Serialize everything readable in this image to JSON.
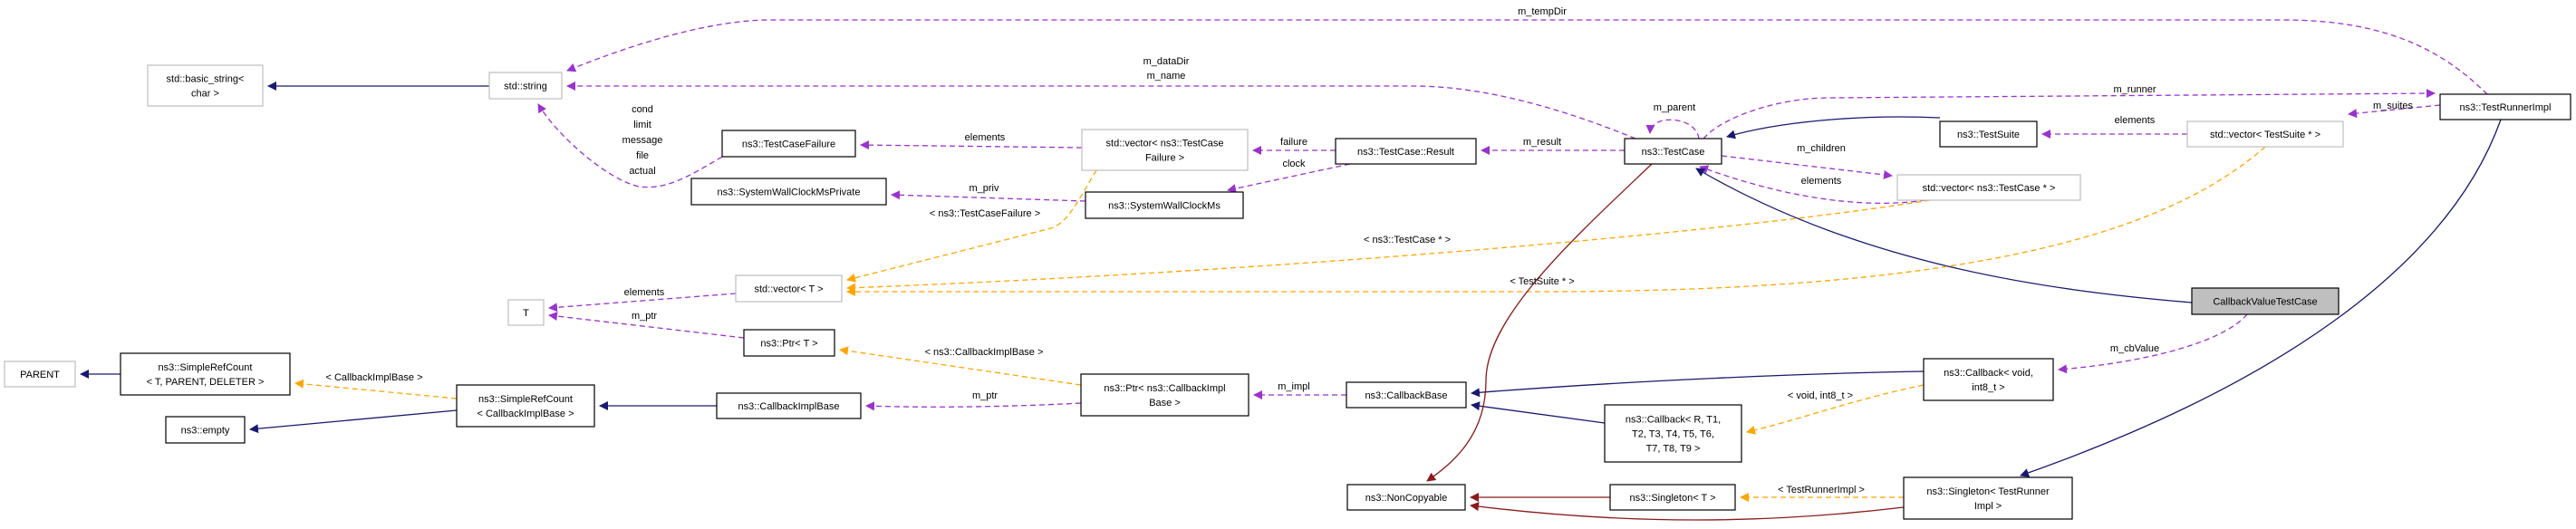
{
  "colors": {
    "inheritance": "#191970",
    "usage": "#9a32cd",
    "template": "#ffa500",
    "private_inheritance": "#8b1a1a",
    "node_border_documented": "#000000",
    "node_border_undocumented": "#bfbfbf",
    "focus_fill": "#bfbfbf"
  },
  "nodes": [
    {
      "id": "basic_string",
      "lines": [
        "std::basic_string<",
        "char >"
      ],
      "kind": "undocumented"
    },
    {
      "id": "string",
      "lines": [
        "std::string"
      ],
      "kind": "undocumented"
    },
    {
      "id": "tcfailure",
      "lines": [
        "ns3::TestCaseFailure"
      ],
      "kind": "documented"
    },
    {
      "id": "swcmpriv",
      "lines": [
        "ns3::SystemWallClockMsPrivate"
      ],
      "kind": "documented"
    },
    {
      "id": "vec_tcf",
      "lines": [
        "std::vector< ns3::TestCase",
        "Failure >"
      ],
      "kind": "undocumented"
    },
    {
      "id": "result",
      "lines": [
        "ns3::TestCase::Result"
      ],
      "kind": "documented"
    },
    {
      "id": "swcm",
      "lines": [
        "ns3::SystemWallClockMs"
      ],
      "kind": "documented"
    },
    {
      "id": "testcase",
      "lines": [
        "ns3::TestCase"
      ],
      "kind": "documented"
    },
    {
      "id": "testsuite",
      "lines": [
        "ns3::TestSuite"
      ],
      "kind": "documented"
    },
    {
      "id": "vec_ts",
      "lines": [
        "std::vector< TestSuite * >"
      ],
      "kind": "undocumented"
    },
    {
      "id": "vec_tc",
      "lines": [
        "std::vector< ns3::TestCase * >"
      ],
      "kind": "undocumented"
    },
    {
      "id": "runnerimpl",
      "lines": [
        "ns3::TestRunnerImpl"
      ],
      "kind": "documented"
    },
    {
      "id": "focus",
      "lines": [
        "CallbackValueTestCase"
      ],
      "kind": "focus"
    },
    {
      "id": "vec_t",
      "lines": [
        "std::vector< T >"
      ],
      "kind": "undocumented"
    },
    {
      "id": "T",
      "lines": [
        "T"
      ],
      "kind": "undocumented"
    },
    {
      "id": "ptr_t",
      "lines": [
        "ns3::Ptr< T >"
      ],
      "kind": "documented"
    },
    {
      "id": "parent",
      "lines": [
        "PARENT"
      ],
      "kind": "undocumented"
    },
    {
      "id": "src_tpd",
      "lines": [
        "ns3::SimpleRefCount",
        "< T, PARENT, DELETER >"
      ],
      "kind": "documented"
    },
    {
      "id": "src_cib",
      "lines": [
        "ns3::SimpleRefCount",
        "< CallbackImplBase >"
      ],
      "kind": "documented"
    },
    {
      "id": "empty",
      "lines": [
        "ns3::empty"
      ],
      "kind": "documented"
    },
    {
      "id": "cib",
      "lines": [
        "ns3::CallbackImplBase"
      ],
      "kind": "documented"
    },
    {
      "id": "ptr_cib",
      "lines": [
        "ns3::Ptr< ns3::CallbackImpl",
        "Base >"
      ],
      "kind": "documented"
    },
    {
      "id": "cbbase",
      "lines": [
        "ns3::CallbackBase"
      ],
      "kind": "documented"
    },
    {
      "id": "cb_generic",
      "lines": [
        "ns3::Callback< R, T1,",
        "T2, T3, T4, T5, T6,",
        "T7, T8, T9 >"
      ],
      "kind": "documented"
    },
    {
      "id": "cb_void",
      "lines": [
        "ns3::Callback< void,",
        "int8_t >"
      ],
      "kind": "documented"
    },
    {
      "id": "noncopyable",
      "lines": [
        "ns3::NonCopyable"
      ],
      "kind": "documented"
    },
    {
      "id": "singleton_t",
      "lines": [
        "ns3::Singleton< T >"
      ],
      "kind": "documented"
    },
    {
      "id": "singleton_tri",
      "lines": [
        "ns3::Singleton< TestRunner",
        "Impl >"
      ],
      "kind": "documented"
    }
  ],
  "edges": [
    {
      "from": "string",
      "to": "basic_string",
      "type": "inheritance",
      "labels": []
    },
    {
      "from": "runnerimpl",
      "to": "string",
      "type": "usage",
      "labels": [
        "m_tempDir"
      ]
    },
    {
      "from": "testcase",
      "to": "string",
      "type": "usage",
      "labels": [
        "m_dataDir",
        "m_name"
      ]
    },
    {
      "from": "tcfailure",
      "to": "string",
      "type": "usage",
      "labels": [
        "cond",
        "limit",
        "message",
        "file",
        "actual"
      ]
    },
    {
      "from": "vec_tcf",
      "to": "tcfailure",
      "type": "usage",
      "labels": [
        "elements"
      ]
    },
    {
      "from": "swcm",
      "to": "swcmpriv",
      "type": "usage",
      "labels": [
        "m_priv"
      ]
    },
    {
      "from": "result",
      "to": "vec_tcf",
      "type": "usage",
      "labels": [
        "failure"
      ]
    },
    {
      "from": "result",
      "to": "swcm",
      "type": "usage",
      "labels": [
        "clock"
      ]
    },
    {
      "from": "testcase",
      "to": "result",
      "type": "usage",
      "labels": [
        "m_result"
      ]
    },
    {
      "from": "testcase",
      "to": "testcase",
      "type": "usage",
      "labels": [
        "m_parent"
      ]
    },
    {
      "from": "testsuite",
      "to": "testcase",
      "type": "inheritance",
      "labels": []
    },
    {
      "from": "testcase",
      "to": "runnerimpl",
      "type": "usage",
      "labels": [
        "m_runner"
      ]
    },
    {
      "from": "runnerimpl",
      "to": "vec_ts",
      "type": "usage",
      "labels": [
        "m_suites"
      ]
    },
    {
      "from": "vec_ts",
      "to": "testsuite",
      "type": "usage",
      "labels": [
        "elements"
      ]
    },
    {
      "from": "testcase",
      "to": "vec_tc",
      "type": "usage",
      "labels": [
        "m_children"
      ]
    },
    {
      "from": "vec_tc",
      "to": "testcase",
      "type": "usage",
      "labels": [
        "elements"
      ]
    },
    {
      "from": "focus",
      "to": "testcase",
      "type": "inheritance",
      "labels": []
    },
    {
      "from": "vec_t",
      "to": "T",
      "type": "usage",
      "labels": [
        "elements"
      ]
    },
    {
      "from": "ptr_t",
      "to": "T",
      "type": "usage",
      "labels": [
        "m_ptr"
      ]
    },
    {
      "from": "vec_tcf",
      "to": "vec_t",
      "type": "template",
      "labels": [
        "< ns3::TestCaseFailure >"
      ]
    },
    {
      "from": "vec_tc",
      "to": "vec_t",
      "type": "template",
      "labels": [
        "< ns3::TestCase * >"
      ]
    },
    {
      "from": "vec_ts",
      "to": "vec_t",
      "type": "template",
      "labels": [
        "< TestSuite * >"
      ]
    },
    {
      "from": "ptr_cib",
      "to": "ptr_t",
      "type": "template",
      "labels": [
        "< ns3::CallbackImplBase >"
      ]
    },
    {
      "from": "ptr_cib",
      "to": "cib",
      "type": "usage",
      "labels": [
        "m_ptr"
      ]
    },
    {
      "from": "cbbase",
      "to": "ptr_cib",
      "type": "usage",
      "labels": [
        "m_impl"
      ]
    },
    {
      "from": "cib",
      "to": "src_cib",
      "type": "inheritance",
      "labels": []
    },
    {
      "from": "src_cib",
      "to": "src_tpd",
      "type": "template",
      "labels": [
        "< CallbackImplBase >"
      ]
    },
    {
      "from": "src_cib",
      "to": "empty",
      "type": "inheritance",
      "labels": []
    },
    {
      "from": "src_tpd",
      "to": "parent",
      "type": "inheritance",
      "labels": []
    },
    {
      "from": "cb_generic",
      "to": "cbbase",
      "type": "inheritance",
      "labels": []
    },
    {
      "from": "cb_void",
      "to": "cbbase",
      "type": "inheritance",
      "labels": []
    },
    {
      "from": "cb_void",
      "to": "cb_generic",
      "type": "template",
      "labels": [
        "< void, int8_t >"
      ]
    },
    {
      "from": "focus",
      "to": "cb_void",
      "type": "usage",
      "labels": [
        "m_cbValue"
      ]
    },
    {
      "from": "testcase",
      "to": "noncopyable",
      "type": "private_inheritance",
      "labels": []
    },
    {
      "from": "singleton_t",
      "to": "noncopyable",
      "type": "private_inheritance",
      "labels": []
    },
    {
      "from": "singleton_tri",
      "to": "noncopyable",
      "type": "private_inheritance",
      "labels": []
    },
    {
      "from": "singleton_tri",
      "to": "singleton_t",
      "type": "template",
      "labels": [
        "< TestRunnerImpl >"
      ]
    },
    {
      "from": "runnerimpl",
      "to": "singleton_tri",
      "type": "inheritance",
      "labels": []
    }
  ]
}
